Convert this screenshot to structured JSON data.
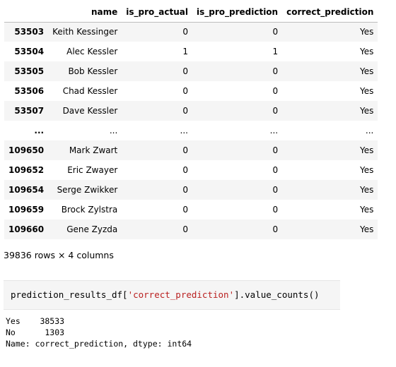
{
  "dataframe": {
    "columns": [
      "name",
      "is_pro_actual",
      "is_pro_prediction",
      "correct_prediction"
    ],
    "rows": [
      {
        "index": "53503",
        "name": "Keith Kessinger",
        "is_pro_actual": "0",
        "is_pro_prediction": "0",
        "correct_prediction": "Yes"
      },
      {
        "index": "53504",
        "name": "Alec Kessler",
        "is_pro_actual": "1",
        "is_pro_prediction": "1",
        "correct_prediction": "Yes"
      },
      {
        "index": "53505",
        "name": "Bob Kessler",
        "is_pro_actual": "0",
        "is_pro_prediction": "0",
        "correct_prediction": "Yes"
      },
      {
        "index": "53506",
        "name": "Chad Kessler",
        "is_pro_actual": "0",
        "is_pro_prediction": "0",
        "correct_prediction": "Yes"
      },
      {
        "index": "53507",
        "name": "Dave Kessler",
        "is_pro_actual": "0",
        "is_pro_prediction": "0",
        "correct_prediction": "Yes"
      },
      {
        "index": "...",
        "name": "...",
        "is_pro_actual": "...",
        "is_pro_prediction": "...",
        "correct_prediction": "..."
      },
      {
        "index": "109650",
        "name": "Mark Zwart",
        "is_pro_actual": "0",
        "is_pro_prediction": "0",
        "correct_prediction": "Yes"
      },
      {
        "index": "109652",
        "name": "Eric Zwayer",
        "is_pro_actual": "0",
        "is_pro_prediction": "0",
        "correct_prediction": "Yes"
      },
      {
        "index": "109654",
        "name": "Serge Zwikker",
        "is_pro_actual": "0",
        "is_pro_prediction": "0",
        "correct_prediction": "Yes"
      },
      {
        "index": "109659",
        "name": "Brock Zylstra",
        "is_pro_actual": "0",
        "is_pro_prediction": "0",
        "correct_prediction": "Yes"
      },
      {
        "index": "109660",
        "name": "Gene Zyzda",
        "is_pro_actual": "0",
        "is_pro_prediction": "0",
        "correct_prediction": "Yes"
      }
    ],
    "shape_text": "39836 rows × 4 columns"
  },
  "code_cell": {
    "var": "prediction_results_df",
    "open_bracket": "[",
    "string": "'correct_prediction'",
    "close_bracket": "]",
    "method": ".value_counts()"
  },
  "output": {
    "lines": [
      "Yes    38533",
      "No      1303",
      "Name: correct_prediction, dtype: int64"
    ]
  }
}
